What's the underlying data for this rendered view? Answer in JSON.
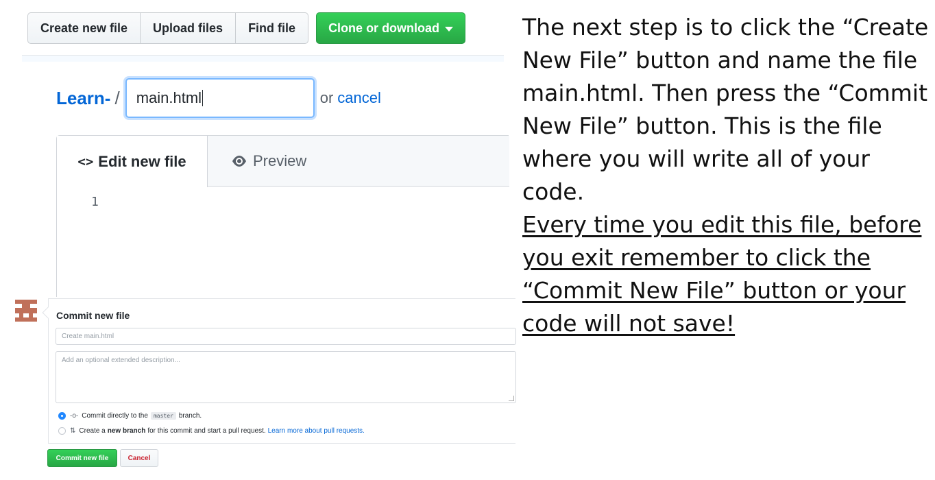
{
  "toolbar": {
    "create_new_file": "Create new file",
    "upload_files": "Upload files",
    "find_file": "Find file",
    "clone_or_download": "Clone or download"
  },
  "path": {
    "repo": "Learn-",
    "separator": "/",
    "filename": "main.html",
    "or_text": "or",
    "cancel": "cancel"
  },
  "editor": {
    "edit_tab_icon": "<>",
    "edit_tab": "Edit new file",
    "preview_tab": "Preview",
    "line_number": "1"
  },
  "commit": {
    "title": "Commit new file",
    "message_placeholder": "Create main.html",
    "description_placeholder": "Add an optional extended description...",
    "option_direct_prefix": "Commit directly to the",
    "option_direct_branch": "master",
    "option_direct_suffix": "branch.",
    "option_branch_prefix": "Create a",
    "option_branch_bold": "new branch",
    "option_branch_suffix": "for this commit and start a pull request.",
    "option_branch_link": "Learn more about pull requests.",
    "commit_button": "Commit new file",
    "cancel_button": "Cancel"
  },
  "instructions": {
    "plain": "The next step is to click the “Create New File” button and name the file main.html.  Then press the “Commit New File” button.  This is the file where you will write all of your code.",
    "underlined": "Every time you edit this file, before you exit remember to click the “Commit New File” button or your code will not save!"
  },
  "colors": {
    "primary_green": "#28a745",
    "link_blue": "#0366d6",
    "focus_blue": "#79b8ff",
    "cancel_red": "#cb2431",
    "avatar_brown": "#c0705a"
  },
  "icons": {
    "clone_caret": "caret-down-icon",
    "code": "code-icon",
    "preview": "eye-icon",
    "commit": "git-commit-icon",
    "pull_request": "git-pull-request-icon",
    "avatar": "identicon-avatar"
  }
}
